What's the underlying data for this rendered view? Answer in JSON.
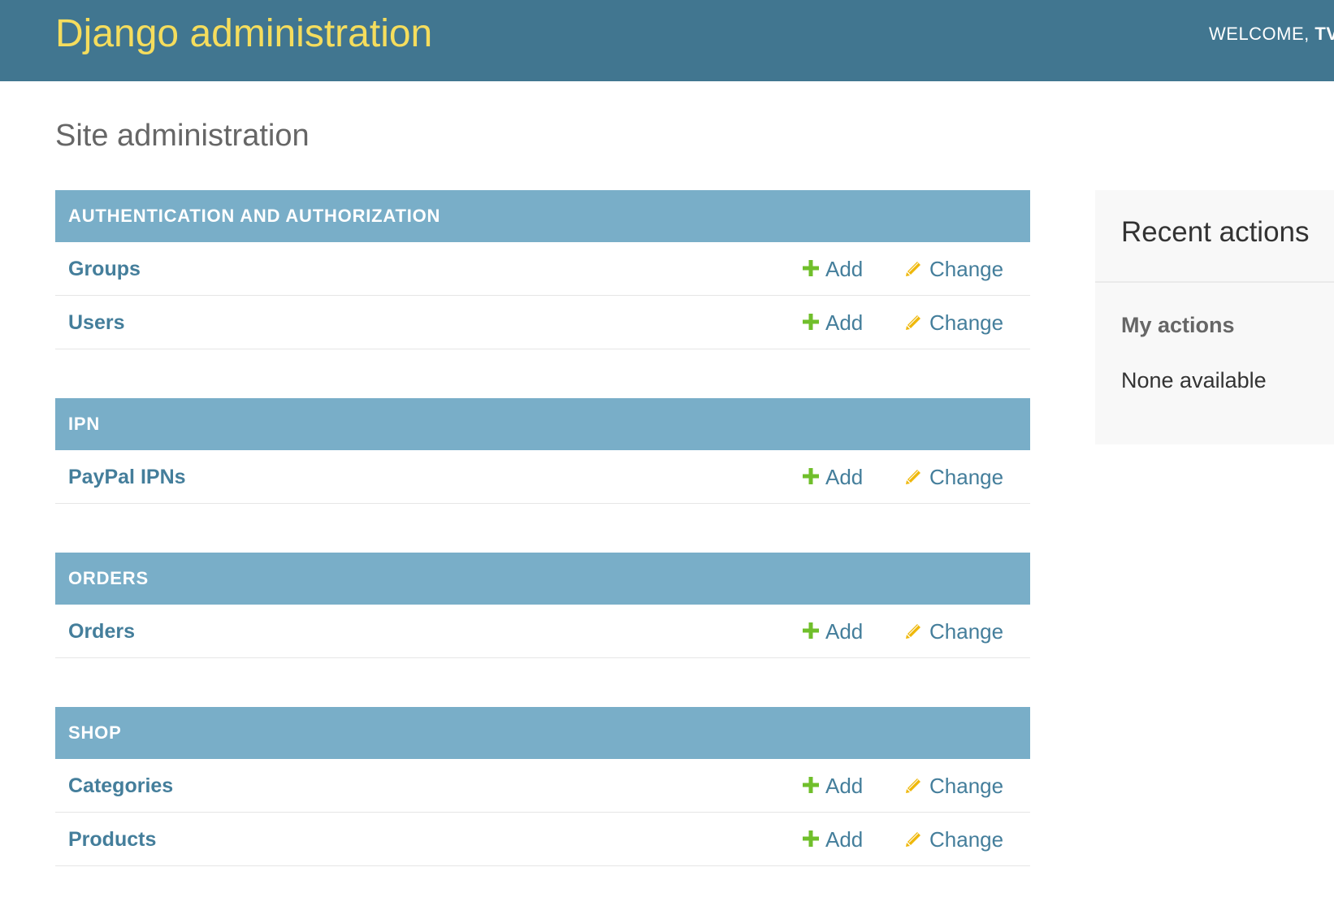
{
  "header": {
    "site_name": "Django administration",
    "welcome_text": "WELCOME, ",
    "username": "TV"
  },
  "page": {
    "title": "Site administration"
  },
  "modules": [
    {
      "caption": "AUTHENTICATION AND AUTHORIZATION",
      "models": [
        {
          "name": "Groups",
          "add_label": "Add",
          "change_label": "Change"
        },
        {
          "name": "Users",
          "add_label": "Add",
          "change_label": "Change"
        }
      ]
    },
    {
      "caption": "IPN",
      "models": [
        {
          "name": "PayPal IPNs",
          "add_label": "Add",
          "change_label": "Change"
        }
      ]
    },
    {
      "caption": "ORDERS",
      "models": [
        {
          "name": "Orders",
          "add_label": "Add",
          "change_label": "Change"
        }
      ]
    },
    {
      "caption": "SHOP",
      "models": [
        {
          "name": "Categories",
          "add_label": "Add",
          "change_label": "Change"
        },
        {
          "name": "Products",
          "add_label": "Add",
          "change_label": "Change"
        }
      ]
    }
  ],
  "recent_actions": {
    "title": "Recent actions",
    "my_actions_label": "My actions",
    "empty_text": "None available"
  },
  "icons": {
    "add": "plus-icon",
    "change": "pencil-icon"
  },
  "colors": {
    "header_bg": "#417690",
    "branding": "#f5dd5d",
    "module_caption_bg": "#79aec8",
    "link": "#447e9b",
    "add_icon": "#70bf2b",
    "change_icon": "#efb80b"
  }
}
